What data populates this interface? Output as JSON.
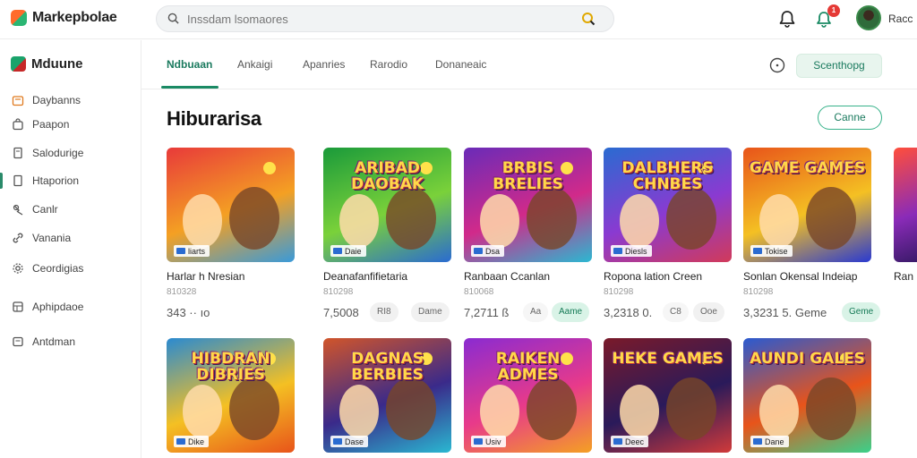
{
  "app": {
    "brand": "Markepbolae",
    "user_name": "Racc"
  },
  "search": {
    "placeholder": "Inssdam lsomaores",
    "value": ""
  },
  "notifications": {
    "count": "1"
  },
  "sidebar": {
    "title": "Mduune",
    "items": [
      {
        "label": "Daybanns",
        "icon": "store-icon"
      },
      {
        "label": "Paapon",
        "icon": "bag-icon"
      },
      {
        "label": "Salodurige",
        "icon": "document-icon"
      },
      {
        "label": "Htaporion",
        "icon": "page-icon"
      },
      {
        "label": "Canlr",
        "icon": "pin-icon"
      },
      {
        "label": "Vanania",
        "icon": "link-icon"
      },
      {
        "label": "Ceordigias",
        "icon": "gear-icon"
      },
      {
        "label": "Aphipdaoe",
        "icon": "app-icon"
      },
      {
        "label": "Antdman",
        "icon": "box-icon"
      }
    ]
  },
  "tabs": [
    {
      "label": "Ndbuaan"
    },
    {
      "label": "Ankaigi"
    },
    {
      "label": "Apanries"
    },
    {
      "label": "Rarodio"
    },
    {
      "label": "Donaneaic"
    }
  ],
  "header": {
    "shop_button": "Scenthopg"
  },
  "section": {
    "title": "Hiburarisa",
    "button": "Canne"
  },
  "cards_row1": [
    {
      "art": "",
      "tag": "liarts",
      "name": "Harlar h Nresian",
      "sub": "810328",
      "price": "3‍43 ·· ıo",
      "btn": "",
      "btn_green": false
    },
    {
      "art": "ARIBAD DAOBAK",
      "tag": "Daie",
      "name": "Deanafanfifietaria",
      "sub": "810298",
      "price": "7,5008",
      "btn": "RI8",
      "btn2": "Dame",
      "btn_green": false
    },
    {
      "art": "BRBIS BRELIES",
      "tag": "Dsa",
      "name": "Ranbaan Ccanlan",
      "sub": "810068",
      "price": "7,2711 ß",
      "btn": "Aa",
      "btn2": "Aame",
      "btn_green": true
    },
    {
      "art": "DALBHERS CHNBES",
      "tag": "Diesls",
      "name": "Ropona lation Creen",
      "sub": "810298",
      "price": "3,2318 0.",
      "btn": "C8",
      "btn2": "Ooe",
      "btn_green": false
    },
    {
      "art": "GAME GAMES",
      "tag": "Tokise",
      "name": "Sonlan Okensal Indeiap",
      "sub": "810298",
      "price": "3,3231 5. Geme",
      "btn": "Geme",
      "btn_green": true
    }
  ],
  "cards_row2": [
    {
      "art": "HIBDRAN DIBRIES",
      "tag": "Dike"
    },
    {
      "art": "DAGNAS BERBIES",
      "tag": "Dase"
    },
    {
      "art": "RAIKEN ADMES",
      "tag": "Usiv"
    },
    {
      "art": "HEKE GAMES",
      "tag": "Deec"
    },
    {
      "art": "AUNDI GALES",
      "tag": "Dane"
    }
  ],
  "colors": {
    "accent": "#1a8a64",
    "accent_light": "#d9f3e7",
    "badge": "#e53935"
  }
}
